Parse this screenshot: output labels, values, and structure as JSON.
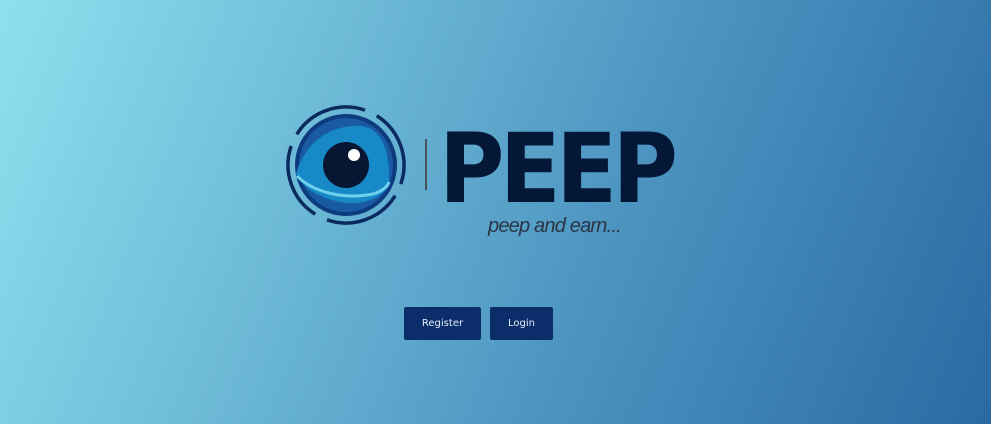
{
  "brand": {
    "name": "PEEP",
    "tagline": "peep and earn...",
    "logo_icon": "eye-icon"
  },
  "actions": {
    "register_label": "Register",
    "login_label": "Login"
  },
  "colors": {
    "background_start": "#8ee0ee",
    "background_end": "#2a6aa3",
    "wordmark": "#041736",
    "button": "#0b2d69",
    "button_text": "#e8eefc"
  }
}
